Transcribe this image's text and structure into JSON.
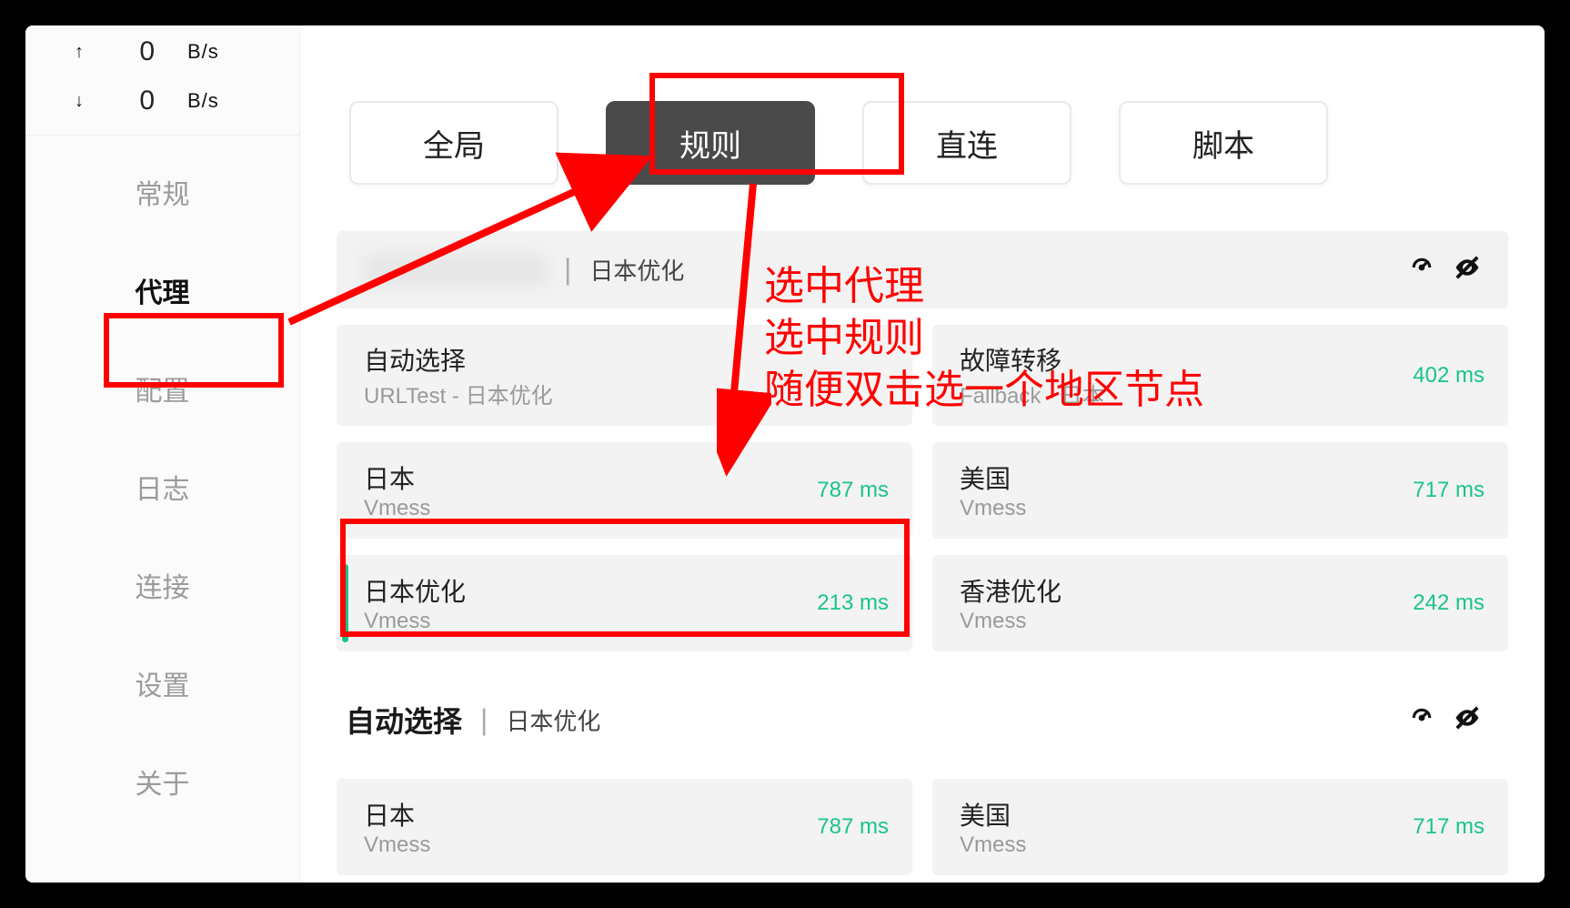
{
  "speed": {
    "up_arrow": "↑",
    "down_arrow": "↓",
    "up_val": "0",
    "down_val": "0",
    "unit": "B/s"
  },
  "nav": {
    "general": "常规",
    "proxy": "代理",
    "profile": "配置",
    "log": "日志",
    "connections": "连接",
    "settings": "设置",
    "about": "关于"
  },
  "modes": {
    "global": "全局",
    "rule": "规则",
    "direct": "直连",
    "script": "脚本"
  },
  "group1": {
    "sep": "|",
    "sub": "日本优化",
    "nodes": [
      {
        "name": "自动选择",
        "proto": "URLTest - 日本优化",
        "ping": ""
      },
      {
        "name": "故障转移",
        "proto": "Fallback - 日本",
        "ping": "402 ms"
      },
      {
        "name": "日本",
        "proto": "Vmess",
        "ping": "787 ms"
      },
      {
        "name": "美国",
        "proto": "Vmess",
        "ping": "717 ms"
      },
      {
        "name": "日本优化",
        "proto": "Vmess",
        "ping": "213 ms"
      },
      {
        "name": "香港优化",
        "proto": "Vmess",
        "ping": "242 ms"
      }
    ]
  },
  "group2": {
    "title": "自动选择",
    "sep": "|",
    "sub": "日本优化",
    "nodes": [
      {
        "name": "日本",
        "proto": "Vmess",
        "ping": "787 ms"
      },
      {
        "name": "美国",
        "proto": "Vmess",
        "ping": "717 ms"
      }
    ]
  },
  "annotations": {
    "line1": "选中代理",
    "line2": "选中规则",
    "line3": "随便双击选一个地区节点"
  }
}
